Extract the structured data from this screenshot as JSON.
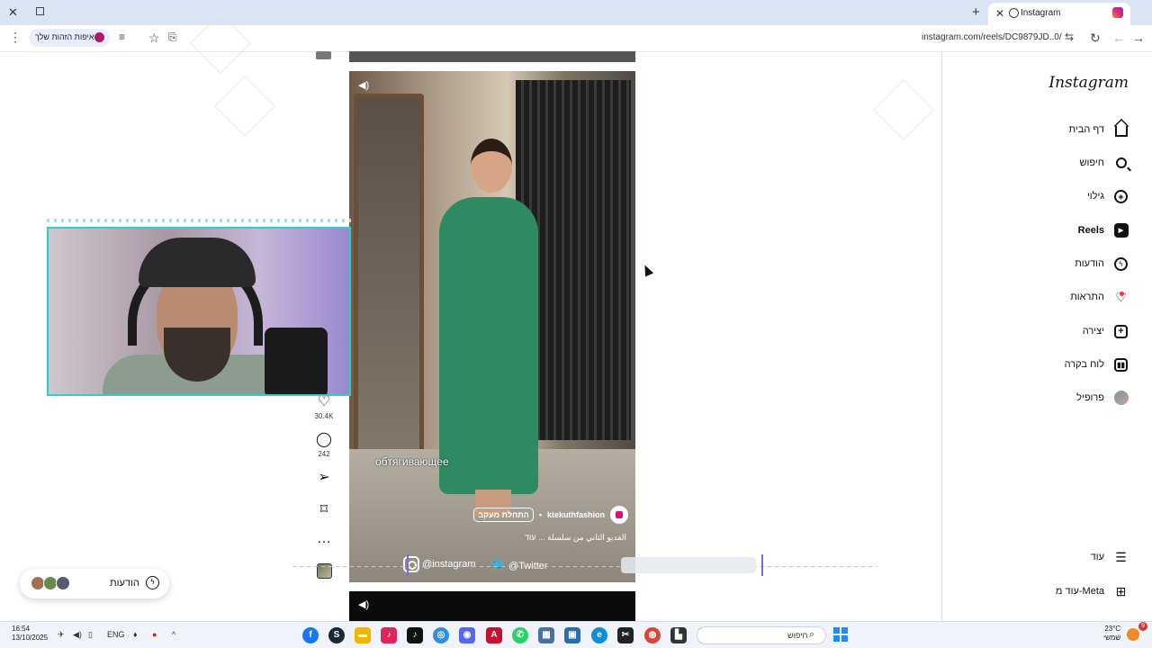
{
  "browser": {
    "tab_title": "Instagram",
    "url": "instagram.com/reels/DC9879JD..0/",
    "identity_chip_label": "איפות הזהות שלך"
  },
  "feed": {
    "reel": {
      "caption_text": "обтягивающее",
      "author_name": "ktekuthfashion",
      "follow_label": "התחלת מעקב",
      "description": "الفديو الثاني من سلسلة ... עוד",
      "overlay_instagram_handle": "@instagram",
      "overlay_twitter_handle": "@Twitter"
    },
    "actions": {
      "like_count": "30.4K",
      "comment_count": "242"
    }
  },
  "messages_chip": {
    "label": "הודעות"
  },
  "sidebar": {
    "logo": "Instagram",
    "items": [
      {
        "label": "דף הבית",
        "icon": "home-icon"
      },
      {
        "label": "חיפוש",
        "icon": "search-icon"
      },
      {
        "label": "גילוי",
        "icon": "compass-icon"
      },
      {
        "label": "Reels",
        "icon": "reels-icon"
      },
      {
        "label": "הודעות",
        "icon": "messenger-icon"
      },
      {
        "label": "התראות",
        "icon": "heart-icon"
      },
      {
        "label": "יצירה",
        "icon": "plus-square-icon"
      },
      {
        "label": "לוח בקרה",
        "icon": "dashboard-icon"
      },
      {
        "label": "פרופיל",
        "icon": "profile-avatar"
      }
    ],
    "more_label": "עוד",
    "meta_label": "עוד מ-Meta"
  },
  "taskbar": {
    "time": "16:54",
    "date": "13/10/2025",
    "lang": "ENG",
    "search_label": "חיפוש",
    "weather_temp": "23°C",
    "weather_text": "שמשי",
    "notification_count": "9"
  }
}
